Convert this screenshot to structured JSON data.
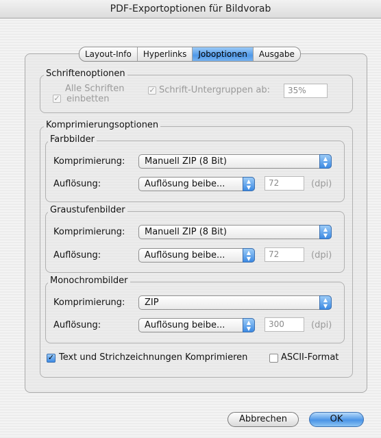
{
  "window": {
    "title": "PDF-Exportoptionen für Bildvorab"
  },
  "tabs": [
    "Layout-Info",
    "Hyperlinks",
    "Joboptionen",
    "Ausgabe"
  ],
  "selected_tab": "Joboptionen",
  "fonts": {
    "legend": "Schriftenoptionen",
    "embed_all_line1": "Alle Schriften",
    "embed_all_line2": "einbetten",
    "embed_all_checked": true,
    "subset_label": "Schrift-Untergruppen ab:",
    "subset_checked": true,
    "subset_value": "35%"
  },
  "compression": {
    "legend": "Komprimierungsoptionen",
    "color": {
      "legend": "Farbbilder",
      "comp_label": "Komprimierung:",
      "comp_value": "Manuell ZIP (8 Bit)",
      "res_label": "Auflösung:",
      "res_value": "Auflösung beibe...",
      "dpi_value": "72",
      "dpi_unit": "(dpi)"
    },
    "gray": {
      "legend": "Graustufenbilder",
      "comp_label": "Komprimierung:",
      "comp_value": "Manuell ZIP (8 Bit)",
      "res_label": "Auflösung:",
      "res_value": "Auflösung beibe...",
      "dpi_value": "72",
      "dpi_unit": "(dpi)"
    },
    "mono": {
      "legend": "Monochrombilder",
      "comp_label": "Komprimierung:",
      "comp_value": "ZIP",
      "res_label": "Auflösung:",
      "res_value": "Auflösung beibe...",
      "dpi_value": "300",
      "dpi_unit": "(dpi)"
    },
    "text_compress_label": "Text und Strichzeichnungen Komprimieren",
    "text_compress_checked": true,
    "ascii_label": "ASCII-Format",
    "ascii_checked": false
  },
  "buttons": {
    "cancel": "Abbrechen",
    "ok": "OK"
  },
  "icons": {
    "checkmark": "✓",
    "popup_arrows": "▲▼"
  }
}
